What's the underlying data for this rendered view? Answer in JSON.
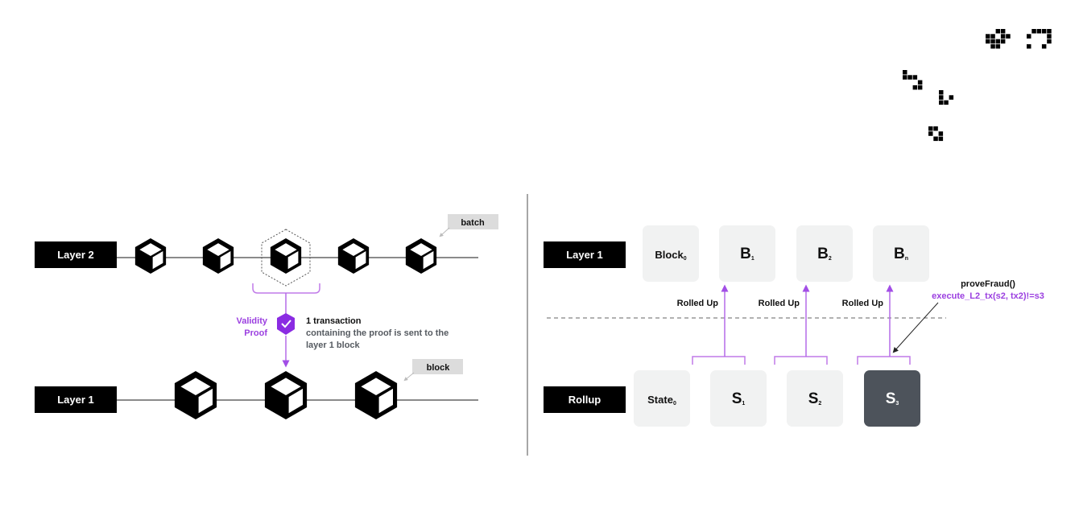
{
  "colors": {
    "black": "#000000",
    "line_gray": "#8a8a8a",
    "purple": "#9b3fe0",
    "purple_light": "#c07ae8",
    "text_gray": "#555a60",
    "tile_light": "#f1f2f2",
    "tile_dark": "#4d535b",
    "callout_bg": "#dcdcdc"
  },
  "decor": {
    "pixel_patterns": [
      "glider-cluster-1",
      "glider-cluster-2",
      "glider-3",
      "glider-4",
      "glider-5"
    ]
  },
  "left_diagram": {
    "layer2_label": "Layer 2",
    "layer1_label": "Layer 1",
    "batch_callout": "batch",
    "block_callout": "block",
    "validity_proof_line1": "Validity",
    "validity_proof_line2": "Proof",
    "transaction_title": "1 transaction",
    "transaction_desc_line1": "containing the proof is sent to the",
    "transaction_desc_line2": "layer 1 block",
    "layer2_block_count": 5,
    "layer1_block_count": 3,
    "highlighted_block_index": 2
  },
  "right_diagram": {
    "layer1_label": "Layer 1",
    "rollup_label": "Rollup",
    "blocks": [
      {
        "main": "Block",
        "sub": "0"
      },
      {
        "main": "B",
        "sub": "1"
      },
      {
        "main": "B",
        "sub": "2"
      },
      {
        "main": "B",
        "sub": "n"
      }
    ],
    "states": [
      {
        "main": "State",
        "sub": "0",
        "dark": false
      },
      {
        "main": "S",
        "sub": "1",
        "dark": false
      },
      {
        "main": "S",
        "sub": "2",
        "dark": false
      },
      {
        "main": "S",
        "sub": "3",
        "dark": true
      }
    ],
    "rolled_up_labels": [
      "Rolled Up",
      "Rolled Up",
      "Rolled Up"
    ],
    "fraud_title": "proveFraud()",
    "fraud_code": "execute_L2_tx(s2, tx2)!=s3"
  }
}
